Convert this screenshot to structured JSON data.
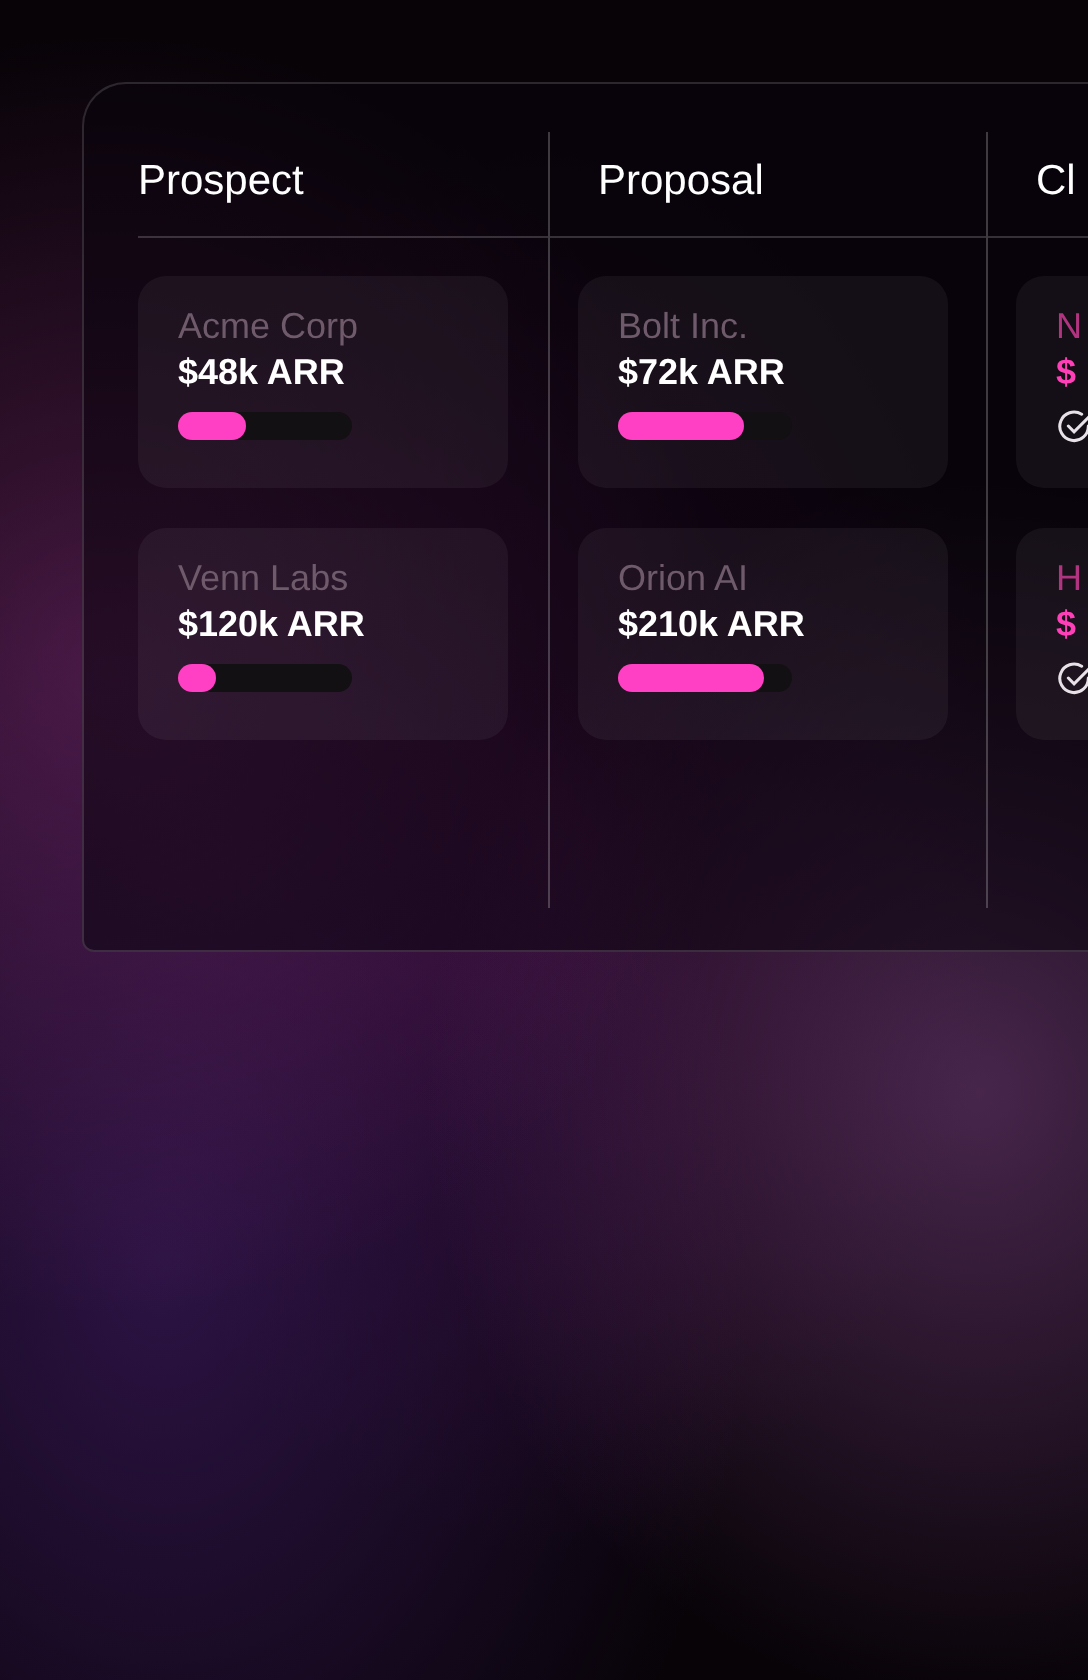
{
  "columns": [
    {
      "title": "Prospect",
      "cards": [
        {
          "kind": "progress",
          "name": "Acme Corp",
          "value": "$48k ARR",
          "level": 0.39
        },
        {
          "kind": "progress",
          "name": "Venn Labs",
          "value": "$120k ARR",
          "level": 0.22
        }
      ]
    },
    {
      "title": "Proposal",
      "cards": [
        {
          "kind": "progress",
          "name": "Bolt Inc.",
          "value": "$72k ARR",
          "level": 0.72
        },
        {
          "kind": "progress",
          "name": "Orion AI",
          "value": "$210k ARR",
          "level": 0.84
        }
      ]
    },
    {
      "title": "Cl",
      "cards": [
        {
          "kind": "won",
          "name": "N",
          "value": "$"
        },
        {
          "kind": "won",
          "name": "H",
          "value": "$"
        }
      ]
    }
  ]
}
